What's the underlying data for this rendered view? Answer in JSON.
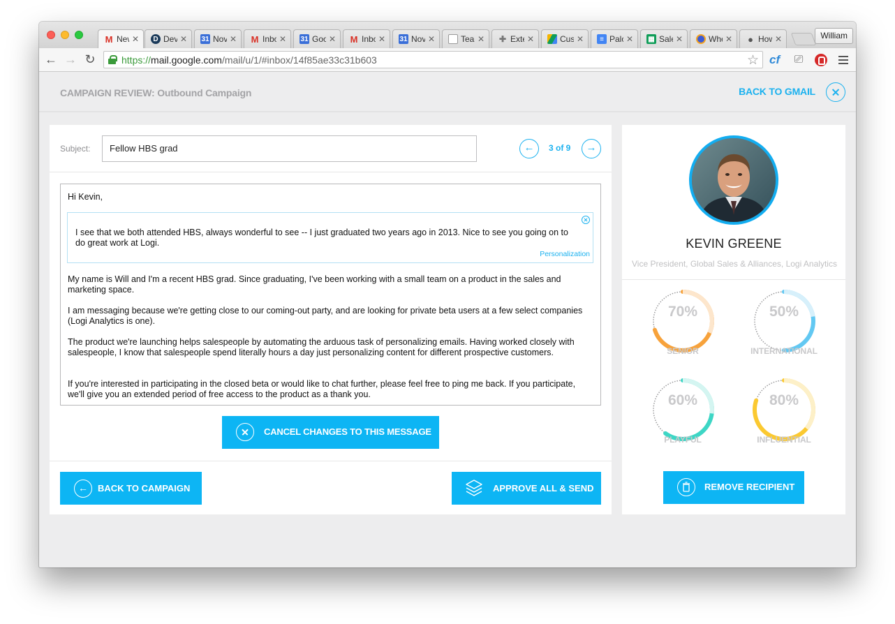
{
  "browser": {
    "tabs": [
      {
        "icon": "gmail-icon",
        "title": "New",
        "active": true
      },
      {
        "icon": "devpost-icon",
        "title": "Dev"
      },
      {
        "icon": "calendar-icon",
        "title": "Nov"
      },
      {
        "icon": "gmail-icon",
        "title": "Inbo"
      },
      {
        "icon": "calendar-icon",
        "title": "Goo"
      },
      {
        "icon": "gmail-icon",
        "title": "Inbo"
      },
      {
        "icon": "calendar-icon",
        "title": "Nov"
      },
      {
        "icon": "document-icon",
        "title": "Tea"
      },
      {
        "icon": "puzzle-icon",
        "title": "Exte"
      },
      {
        "icon": "drive-icon",
        "title": "Cus"
      },
      {
        "icon": "docs-icon",
        "title": "Palo"
      },
      {
        "icon": "sheets-icon",
        "title": "Sale"
      },
      {
        "icon": "circle-app-icon",
        "title": "Whe"
      },
      {
        "icon": "apple-icon",
        "title": "How"
      }
    ],
    "profile_name": "William",
    "url": {
      "scheme": "https://",
      "host": "mail.google.com",
      "path": "/mail/u/1/#inbox/14f85ae33c31b603"
    },
    "extension_cf": "cf"
  },
  "app": {
    "header_title": "CAMPAIGN REVIEW: Outbound Campaign",
    "back_to_gmail": "BACK TO GMAIL",
    "subject_label": "Subject:",
    "subject_value": "Fellow HBS grad",
    "pager": "3 of 9",
    "message": {
      "greeting": "Hi Kevin,",
      "personalization_text": "I see that we both attended HBS, always wonderful to see -- I just graduated two years ago in 2013. Nice to see you going on to do great work at Logi.",
      "personalization_tag": "Personalization",
      "paragraphs": [
        "My name is Will and I'm a recent HBS grad. Since graduating, I've been working with a small team on a product in the sales and marketing space.",
        "I am messaging because we're getting close to our coming-out party, and are looking for private beta users at a few select companies (Logi Analytics is one).",
        "The product we're launching helps salespeople by automating the arduous task of personalizing emails. Having worked closely with salespeople, I know that salespeople spend literally hours a day just personalizing content for different prospective customers.",
        "If you're interested in participating in the closed beta or would like to chat further, please feel free to ping me back. If you participate, we'll give you an extended period of free access to the product as a thank you."
      ]
    },
    "cancel_button": "CANCEL CHANGES TO THIS MESSAGE",
    "back_button": "BACK TO CAMPAIGN",
    "approve_button": "APPROVE ALL & SEND",
    "contact": {
      "name": "KEVIN GREENE",
      "title": "Vice President, Global Sales & Alliances, Logi Analytics"
    },
    "traits": [
      {
        "label": "SENIOR",
        "percent": "70%",
        "value": 0.7,
        "color": "#f7a23b",
        "track": "#fde6cc"
      },
      {
        "label": "INTERNATIONAL",
        "percent": "50%",
        "value": 0.5,
        "color": "#62c8f2",
        "track": "#d7f0fb"
      },
      {
        "label": "PLAYFUL",
        "percent": "60%",
        "value": 0.6,
        "color": "#3dd6c5",
        "track": "#d4f5f1"
      },
      {
        "label": "INFLUENTIAL",
        "percent": "80%",
        "value": 0.8,
        "color": "#fbc931",
        "track": "#fdf0c8"
      }
    ],
    "remove_button": "REMOVE RECIPIENT",
    "accent_color": "#0db5f4"
  }
}
